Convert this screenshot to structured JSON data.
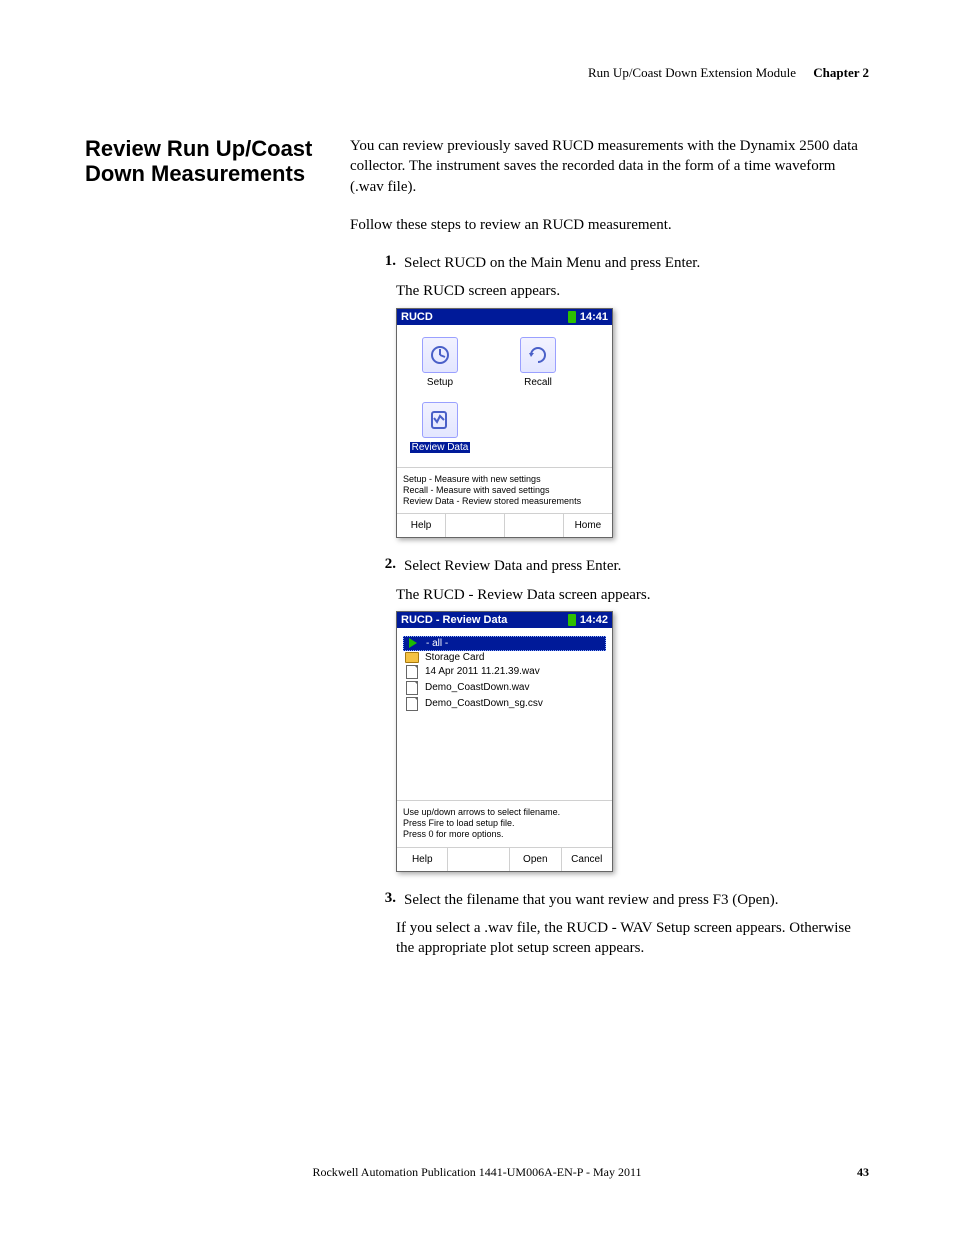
{
  "header": {
    "module": "Run Up/Coast Down Extension Module",
    "chapter_label": "Chapter 2"
  },
  "section_title": "Review Run Up/Coast Down Measurements",
  "intro": "You can review previously saved RUCD measurements with the Dynamix 2500 data collector. The instrument saves the recorded data in the form of a time waveform (.wav file).",
  "follow": "Follow these steps to review an RUCD measurement.",
  "steps": {
    "s1": {
      "num": "1.",
      "text": "Select RUCD on the Main Menu and press Enter.",
      "caption": "The RUCD screen appears."
    },
    "s2": {
      "num": "2.",
      "text": "Select Review Data and press Enter.",
      "caption": "The RUCD - Review Data screen appears."
    },
    "s3": {
      "num": "3.",
      "text": "Select the filename that you want review and press F3 (Open).",
      "caption": "If you select a .wav file, the RUCD - WAV Setup screen appears. Otherwise the appropriate plot setup screen appears."
    }
  },
  "screen1": {
    "title": "RUCD",
    "time": "14:41",
    "icons": {
      "setup": "Setup",
      "recall": "Recall",
      "review": "Review Data"
    },
    "status_l1": "Setup - Measure with new settings",
    "status_l2": "Recall - Measure with saved settings",
    "status_l3": "Review Data - Review stored measurements",
    "softkeys": {
      "help": "Help",
      "home": "Home"
    }
  },
  "screen2": {
    "title": "RUCD - Review Data",
    "time": "14:42",
    "rows": {
      "all": "- all -",
      "storage": "Storage Card",
      "f1": "14 Apr 2011 11.21.39.wav",
      "f2": "Demo_CoastDown.wav",
      "f3": "Demo_CoastDown_sg.csv"
    },
    "status_l1": "Use up/down arrows to select filename.",
    "status_l2": "Press Fire to load setup file.",
    "status_l3": "Press 0 for more options.",
    "softkeys": {
      "help": "Help",
      "open": "Open",
      "cancel": "Cancel"
    }
  },
  "footer": {
    "pub": "Rockwell Automation Publication 1441-UM006A-EN-P - May 2011",
    "page": "43"
  }
}
